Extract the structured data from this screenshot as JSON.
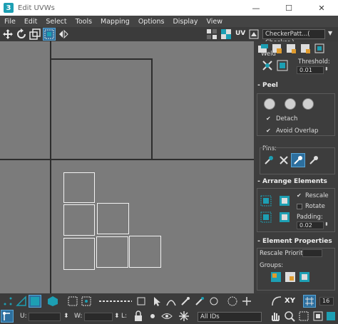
{
  "window": {
    "title": "Edit UVWs",
    "app_icon": "3",
    "minimize": "—",
    "maximize": "☐",
    "close": "✕"
  },
  "menu": [
    "File",
    "Edit",
    "Select",
    "Tools",
    "Mapping",
    "Options",
    "Display",
    "View"
  ],
  "toolbar_top": {
    "uv_label": "UV",
    "texture_select": "CheckerPatt...( Checker )"
  },
  "weld": {
    "title": "Weld",
    "threshold_label": "Threshold:",
    "threshold_value": "0.01"
  },
  "peel": {
    "title": "Peel",
    "toggle": "-",
    "detach_label": "Detach",
    "detach_checked": true,
    "avoid_overlap_label": "Avoid Overlap",
    "avoid_overlap_checked": true,
    "pins_label": "Pins:"
  },
  "arrange": {
    "title": "Arrange Elements",
    "toggle": "-",
    "rescale_label": "Rescale",
    "rescale_checked": true,
    "rotate_label": "Rotate",
    "rotate_checked": false,
    "padding_label": "Padding:",
    "padding_value": "0.02"
  },
  "element_props": {
    "title": "Element Properties",
    "toggle": "-",
    "rescale_priority_label": "Rescale Priority:",
    "groups_label": "Groups:"
  },
  "statusbar": {
    "u_label": "U:",
    "w_label": "W:",
    "l_label": "L:",
    "ids_select": "All IDs",
    "xy_label": "XY",
    "zoom_value": "16"
  },
  "colors": {
    "viewport_bg": "#7b7b7b",
    "accent": "#1d9fb3",
    "active": "#2d6f9e"
  }
}
